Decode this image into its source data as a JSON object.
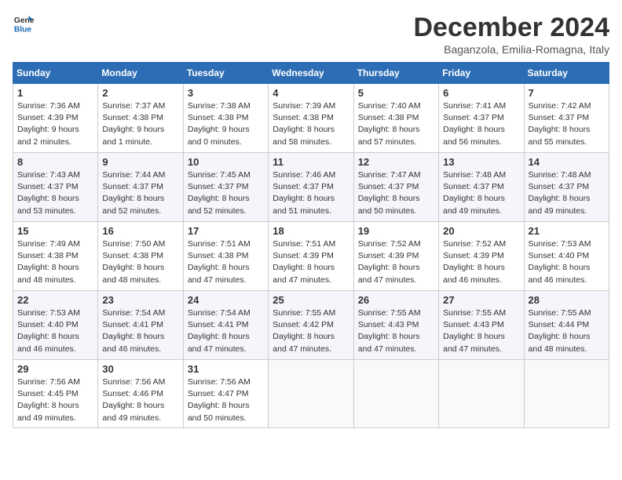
{
  "logo": {
    "line1": "General",
    "line2": "Blue"
  },
  "title": "December 2024",
  "subtitle": "Baganzola, Emilia-Romagna, Italy",
  "headers": [
    "Sunday",
    "Monday",
    "Tuesday",
    "Wednesday",
    "Thursday",
    "Friday",
    "Saturday"
  ],
  "weeks": [
    [
      {
        "day": "1",
        "info": "Sunrise: 7:36 AM\nSunset: 4:39 PM\nDaylight: 9 hours\nand 2 minutes."
      },
      {
        "day": "2",
        "info": "Sunrise: 7:37 AM\nSunset: 4:38 PM\nDaylight: 9 hours\nand 1 minute."
      },
      {
        "day": "3",
        "info": "Sunrise: 7:38 AM\nSunset: 4:38 PM\nDaylight: 9 hours\nand 0 minutes."
      },
      {
        "day": "4",
        "info": "Sunrise: 7:39 AM\nSunset: 4:38 PM\nDaylight: 8 hours\nand 58 minutes."
      },
      {
        "day": "5",
        "info": "Sunrise: 7:40 AM\nSunset: 4:38 PM\nDaylight: 8 hours\nand 57 minutes."
      },
      {
        "day": "6",
        "info": "Sunrise: 7:41 AM\nSunset: 4:37 PM\nDaylight: 8 hours\nand 56 minutes."
      },
      {
        "day": "7",
        "info": "Sunrise: 7:42 AM\nSunset: 4:37 PM\nDaylight: 8 hours\nand 55 minutes."
      }
    ],
    [
      {
        "day": "8",
        "info": "Sunrise: 7:43 AM\nSunset: 4:37 PM\nDaylight: 8 hours\nand 53 minutes."
      },
      {
        "day": "9",
        "info": "Sunrise: 7:44 AM\nSunset: 4:37 PM\nDaylight: 8 hours\nand 52 minutes."
      },
      {
        "day": "10",
        "info": "Sunrise: 7:45 AM\nSunset: 4:37 PM\nDaylight: 8 hours\nand 52 minutes."
      },
      {
        "day": "11",
        "info": "Sunrise: 7:46 AM\nSunset: 4:37 PM\nDaylight: 8 hours\nand 51 minutes."
      },
      {
        "day": "12",
        "info": "Sunrise: 7:47 AM\nSunset: 4:37 PM\nDaylight: 8 hours\nand 50 minutes."
      },
      {
        "day": "13",
        "info": "Sunrise: 7:48 AM\nSunset: 4:37 PM\nDaylight: 8 hours\nand 49 minutes."
      },
      {
        "day": "14",
        "info": "Sunrise: 7:48 AM\nSunset: 4:37 PM\nDaylight: 8 hours\nand 49 minutes."
      }
    ],
    [
      {
        "day": "15",
        "info": "Sunrise: 7:49 AM\nSunset: 4:38 PM\nDaylight: 8 hours\nand 48 minutes."
      },
      {
        "day": "16",
        "info": "Sunrise: 7:50 AM\nSunset: 4:38 PM\nDaylight: 8 hours\nand 48 minutes."
      },
      {
        "day": "17",
        "info": "Sunrise: 7:51 AM\nSunset: 4:38 PM\nDaylight: 8 hours\nand 47 minutes."
      },
      {
        "day": "18",
        "info": "Sunrise: 7:51 AM\nSunset: 4:39 PM\nDaylight: 8 hours\nand 47 minutes."
      },
      {
        "day": "19",
        "info": "Sunrise: 7:52 AM\nSunset: 4:39 PM\nDaylight: 8 hours\nand 47 minutes."
      },
      {
        "day": "20",
        "info": "Sunrise: 7:52 AM\nSunset: 4:39 PM\nDaylight: 8 hours\nand 46 minutes."
      },
      {
        "day": "21",
        "info": "Sunrise: 7:53 AM\nSunset: 4:40 PM\nDaylight: 8 hours\nand 46 minutes."
      }
    ],
    [
      {
        "day": "22",
        "info": "Sunrise: 7:53 AM\nSunset: 4:40 PM\nDaylight: 8 hours\nand 46 minutes."
      },
      {
        "day": "23",
        "info": "Sunrise: 7:54 AM\nSunset: 4:41 PM\nDaylight: 8 hours\nand 46 minutes."
      },
      {
        "day": "24",
        "info": "Sunrise: 7:54 AM\nSunset: 4:41 PM\nDaylight: 8 hours\nand 47 minutes."
      },
      {
        "day": "25",
        "info": "Sunrise: 7:55 AM\nSunset: 4:42 PM\nDaylight: 8 hours\nand 47 minutes."
      },
      {
        "day": "26",
        "info": "Sunrise: 7:55 AM\nSunset: 4:43 PM\nDaylight: 8 hours\nand 47 minutes."
      },
      {
        "day": "27",
        "info": "Sunrise: 7:55 AM\nSunset: 4:43 PM\nDaylight: 8 hours\nand 47 minutes."
      },
      {
        "day": "28",
        "info": "Sunrise: 7:55 AM\nSunset: 4:44 PM\nDaylight: 8 hours\nand 48 minutes."
      }
    ],
    [
      {
        "day": "29",
        "info": "Sunrise: 7:56 AM\nSunset: 4:45 PM\nDaylight: 8 hours\nand 49 minutes."
      },
      {
        "day": "30",
        "info": "Sunrise: 7:56 AM\nSunset: 4:46 PM\nDaylight: 8 hours\nand 49 minutes."
      },
      {
        "day": "31",
        "info": "Sunrise: 7:56 AM\nSunset: 4:47 PM\nDaylight: 8 hours\nand 50 minutes."
      },
      {
        "day": "",
        "info": ""
      },
      {
        "day": "",
        "info": ""
      },
      {
        "day": "",
        "info": ""
      },
      {
        "day": "",
        "info": ""
      }
    ]
  ]
}
